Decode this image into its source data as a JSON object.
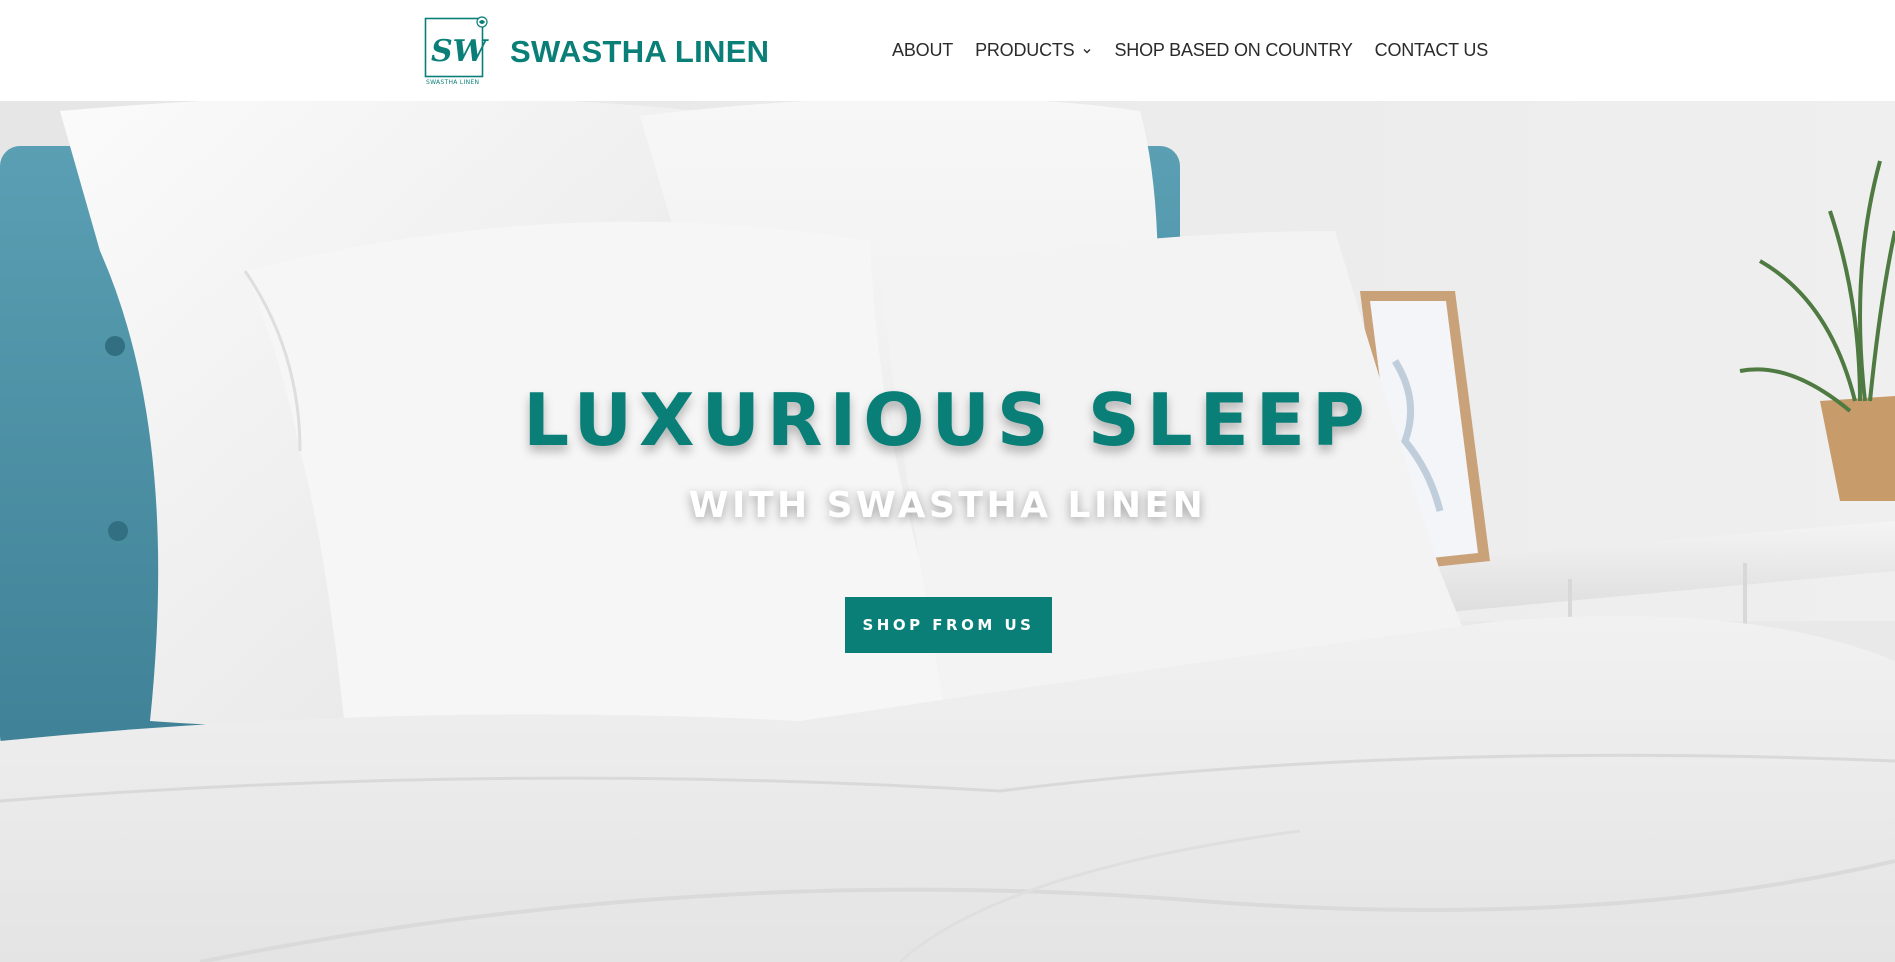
{
  "brand": {
    "name": "SWASTHA LINEN",
    "logo_monogram": "SW",
    "logo_caption": "SWASTHA LINEN",
    "accent_color": "#0a7f78"
  },
  "nav": {
    "items": [
      {
        "label": "ABOUT",
        "has_dropdown": false
      },
      {
        "label": "PRODUCTS",
        "has_dropdown": true,
        "icon": "chevron-down-icon"
      },
      {
        "label": "SHOP BASED ON COUNTRY",
        "has_dropdown": false
      },
      {
        "label": "CONTACT US",
        "has_dropdown": false
      }
    ]
  },
  "hero": {
    "title": "LUXURIOUS SLEEP",
    "subtitle": "WITH SWASTHA LINEN",
    "cta_label": "SHOP FROM US",
    "background": "white pillows and duvet on a bed with teal upholstered headboard"
  }
}
